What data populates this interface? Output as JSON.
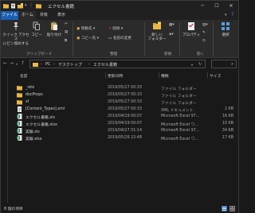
{
  "window": {
    "title": "エクセル書籍"
  },
  "ribbon_tabs": {
    "file": "ファイル",
    "home": "ホーム",
    "share": "共有",
    "view": "表示"
  },
  "ribbon": {
    "pin": "クイック アクセス\nにピン留めする",
    "copy": "コピー",
    "paste": "貼り付け",
    "clipboard_group": "クリップボード",
    "move_to": "移動先 ▾",
    "copy_to": "コピー先 ▾",
    "delete": "削除 ▾",
    "rename": "名前の変更",
    "organize_group": "整理",
    "new_folder": "新しい\nフォルダー",
    "new_group": "新規",
    "properties": "プロパティ",
    "open_group": "開く",
    "select": "選択"
  },
  "address": {
    "crumbs": [
      "PC",
      "デスクトップ",
      "エクセル書籍"
    ]
  },
  "columns": {
    "name": "名前",
    "date": "更新日時",
    "type": "種類",
    "size": "サイズ"
  },
  "files": [
    {
      "name": "_rels",
      "date": "2019/05/27 00:33",
      "type": "ファイル フォルダー",
      "size": "",
      "icon": "folder-icon"
    },
    {
      "name": "docProps",
      "date": "2019/05/27 00:33",
      "type": "ファイル フォルダー",
      "size": "",
      "icon": "folder-icon"
    },
    {
      "name": "xl",
      "date": "2019/05/27 00:33",
      "type": "ファイル フォルダー",
      "size": "",
      "icon": "folder-icon"
    },
    {
      "name": "[Content_Types].xml",
      "date": "2019/05/27 00:33",
      "type": "XML ドキュメント",
      "size": "2 KB",
      "icon": "xml-file-icon"
    },
    {
      "name": "エクセル書籍.xls",
      "date": "2019/04/19 00:07",
      "type": "Microsoft Excel 97...",
      "size": "16 KB",
      "icon": "excel-file-icon"
    },
    {
      "name": "エクセル書籍.xlsx",
      "date": "2019/04/19 00:07",
      "type": "Microsoft Excel ワ...",
      "size": "10 KB",
      "icon": "excel-file-icon"
    },
    {
      "name": "実験.xls",
      "date": "2019/04/27 01:14",
      "type": "Microsoft Excel 97...",
      "size": "34 KB",
      "icon": "excel-file-icon"
    },
    {
      "name": "実験.xlsx",
      "date": "2019/05/26 22:48",
      "type": "Microsoft Excel ワ...",
      "size": "17 KB",
      "icon": "excel-file-icon"
    }
  ],
  "status": {
    "count": "8 個の項目"
  },
  "colors": {
    "accent": "#1a5fb4",
    "folder": "#e8b84a",
    "excel": "#1f7244",
    "background": "#191919"
  }
}
